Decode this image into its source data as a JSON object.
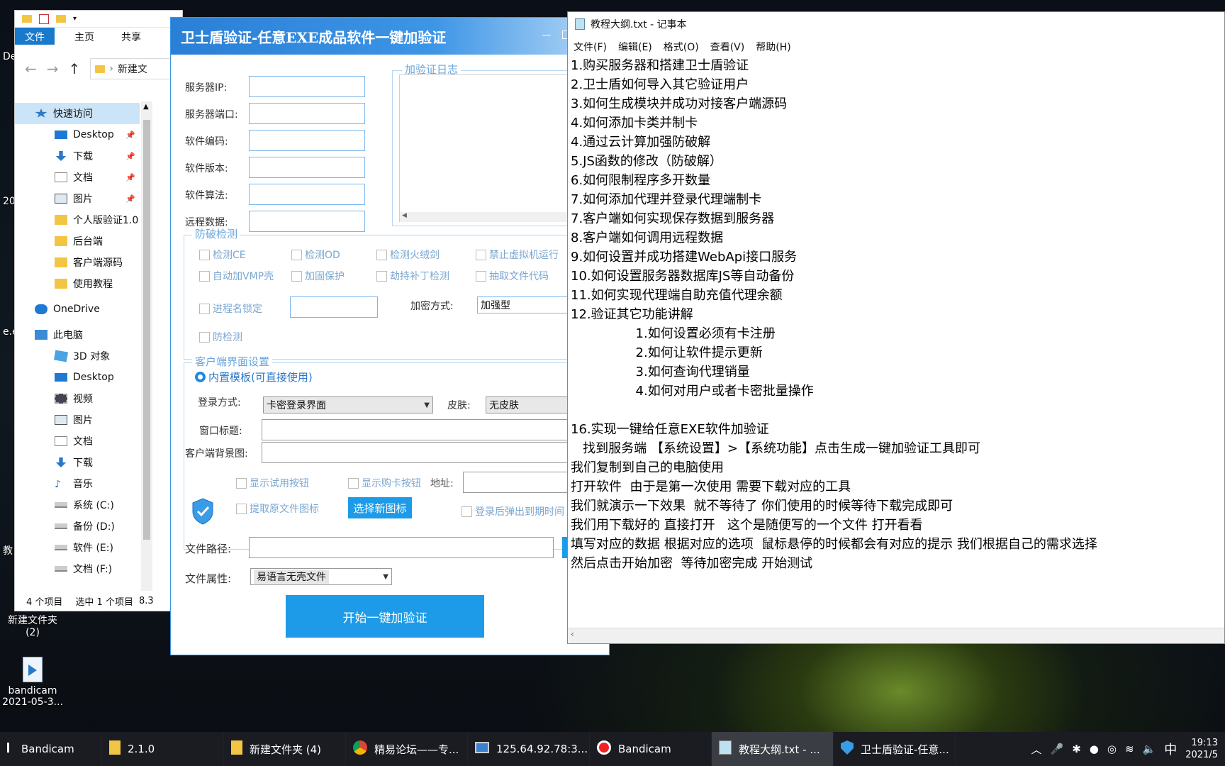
{
  "desktop": {
    "icon_folder_label": "新建文件夹\n(2)",
    "icon_bandicam_label": "bandicam\n2021-05-3...",
    "edge_labels": [
      "De",
      "20",
      "e.e",
      "教"
    ]
  },
  "explorer": {
    "ribbon": [
      "文件",
      "主页",
      "共享"
    ],
    "address": "新建文",
    "nav": [
      {
        "label": "快速访问",
        "icon": "star-icon"
      },
      {
        "label": "Desktop",
        "icon": "desktop-icon",
        "pinned": true
      },
      {
        "label": "下载",
        "icon": "download-icon",
        "pinned": true
      },
      {
        "label": "文档",
        "icon": "document-icon",
        "pinned": true
      },
      {
        "label": "图片",
        "icon": "picture-icon",
        "pinned": true
      },
      {
        "label": "个人版验证1.0",
        "icon": "folder-icon"
      },
      {
        "label": "后台端",
        "icon": "folder-icon"
      },
      {
        "label": "客户端源码",
        "icon": "folder-icon"
      },
      {
        "label": "使用教程",
        "icon": "folder-icon"
      },
      {
        "label": "OneDrive",
        "icon": "cloud-icon"
      },
      {
        "label": "此电脑",
        "icon": "computer-icon"
      },
      {
        "label": "3D 对象",
        "icon": "cube-icon"
      },
      {
        "label": "Desktop",
        "icon": "desktop-icon"
      },
      {
        "label": "视频",
        "icon": "video-icon"
      },
      {
        "label": "图片",
        "icon": "picture-icon"
      },
      {
        "label": "文档",
        "icon": "document-icon"
      },
      {
        "label": "下载",
        "icon": "download-icon"
      },
      {
        "label": "音乐",
        "icon": "music-icon"
      },
      {
        "label": "系统 (C:)",
        "icon": "drive-icon"
      },
      {
        "label": "备份 (D:)",
        "icon": "drive-icon"
      },
      {
        "label": "软件 (E:)",
        "icon": "drive-icon"
      },
      {
        "label": "文档 (F:)",
        "icon": "drive-icon"
      }
    ],
    "status": {
      "count": "4 个项目",
      "selected": "选中 1 个项目",
      "size": "8.3"
    }
  },
  "tool": {
    "title": "卫士盾验证-任意EXE成品软件一键加验证",
    "fields": [
      "服务器IP:",
      "服务器端口:",
      "软件编码:",
      "软件版本:",
      "软件算法:",
      "远程数据:"
    ],
    "log_title": "加验证日志",
    "anti_title": "防破检测",
    "checks": [
      "检测CE",
      "检测OD",
      "检测火绒剑",
      "禁止虚拟机运行",
      "自动加VMP壳",
      "加固保护",
      "劫持补丁检测",
      "抽取文件代码",
      "进程名锁定",
      "防检测"
    ],
    "encrypt_label": "加密方式:",
    "encrypt_value": "加强型",
    "client_title": "客户端界面设置",
    "radio_builtin": "内置模板(可直接使用)",
    "login_label": "登录方式:",
    "login_value": "卡密登录界面",
    "skin_label": "皮肤:",
    "skin_value": "无皮肤",
    "window_title_label": "窗口标题:",
    "bg_label": "客户端背景图:",
    "show_trial": "显示试用按钮",
    "show_buy": "显示购卡按钮",
    "addr_label": "地址:",
    "extract_icon": "提取原文件图标",
    "select_icon_btn": "选择新图标",
    "popup_expire": "登录后弹出到期时间",
    "path_label": "文件路径:",
    "attr_label": "文件属性:",
    "attr_value": "易语言无壳文件",
    "start_btn": "开始一键加验证"
  },
  "notepad": {
    "title": "教程大纲.txt - 记事本",
    "menu": [
      "文件(F)",
      "编辑(E)",
      "格式(O)",
      "查看(V)",
      "帮助(H)"
    ],
    "lines": [
      "1.购买服务器和搭建卫士盾验证",
      "2.卫士盾如何导入其它验证用户",
      "3.如何生成模块并成功对接客户端源码",
      "4.如何添加卡类并制卡",
      "4.通过云计算加强防破解",
      "5.JS函数的修改（防破解）",
      "6.如何限制程序多开数量",
      "7.如何添加代理并登录代理端制卡",
      "7.客户端如何实现保存数据到服务器",
      "8.客户端如何调用远程数据",
      "9.如何设置并成功搭建WebApi接口服务",
      "10.如何设置服务器数据库JS等自动备份",
      "11.如何实现代理端自助充值代理余额",
      "12.验证其它功能讲解",
      "                1.如何设置必须有卡注册",
      "                2.如何让软件提示更新",
      "                3.如何查询代理销量",
      "                4.如何对用户或者卡密批量操作",
      "",
      "16.实现一键给任意EXE软件加验证",
      "   找到服务端 【系统设置】>【系统功能】点击生成一键加验证工具即可",
      "我们复制到自己的电脑使用",
      "打开软件  由于是第一次使用 需要下载对应的工具",
      "我们就演示一下效果  就不等待了 你们使用的时候等待下载完成即可",
      "我们用下载好的 直接打开   这个是随便写的一个文件 打开看看",
      "填写对应的数据 根据对应的选项  鼠标悬停的时候都会有对应的提示 我们根据自己的需求选择",
      "然后点击开始加密  等待加密完成 开始测试"
    ]
  },
  "taskbar": {
    "items": [
      {
        "label": "Bandicam",
        "icon": "bandicam-icon"
      },
      {
        "label": "2.1.0",
        "icon": "folder-icon"
      },
      {
        "label": "新建文件夹 (4)",
        "icon": "folder-icon"
      },
      {
        "label": "精易论坛——专...",
        "icon": "chrome-icon"
      },
      {
        "label": "125.64.92.78:3...",
        "icon": "remote-desktop-icon"
      },
      {
        "label": "Bandicam",
        "icon": "record-icon"
      },
      {
        "label": "教程大纲.txt - ...",
        "icon": "notepad-icon"
      },
      {
        "label": "卫士盾验证-任意...",
        "icon": "shield-icon"
      }
    ],
    "tray_ime": "中",
    "time": "19:13",
    "date": "2021/5"
  }
}
